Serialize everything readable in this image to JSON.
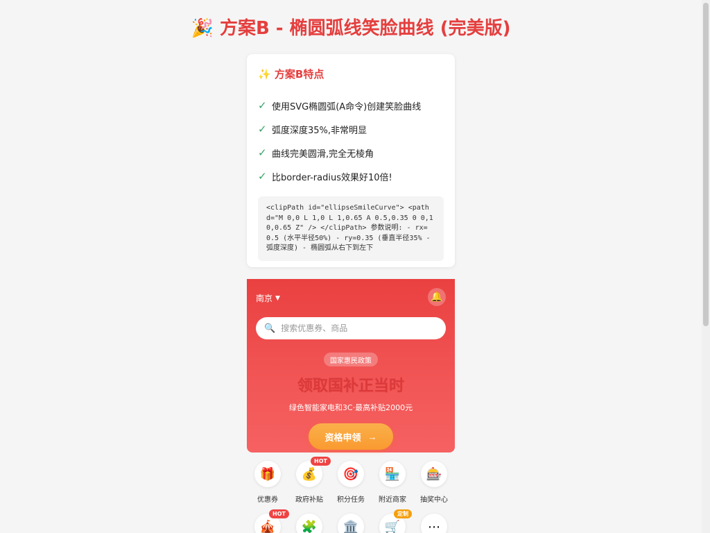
{
  "page": {
    "title": "🎉 方案B - 椭圆弧线笑脸曲线 (完美版)"
  },
  "card": {
    "title": "✨ 方案B特点",
    "features": [
      "使用SVG椭圆弧(A命令)创建笑脸曲线",
      "弧度深度35%,非常明显",
      "曲线完美圆滑,完全无棱角",
      "比border-radius效果好10倍!"
    ],
    "check_mark": "✓",
    "code": "<clipPath id=\"ellipseSmileCurve\"> <path d=\"M 0,0 L 1,0 L 1,0.65 A 0.5,0.35 0 0,1 0,0.65 Z\" /> </clipPath> 参数说明: - rx=0.5 (水平半径50%) - ry=0.35 (垂直半径35% - 弧度深度) - 椭圆弧从右下到左下"
  },
  "app": {
    "city": "南京",
    "city_arrow": "▼",
    "bell_icon": "🔔",
    "search": {
      "icon": "🔍",
      "placeholder": "搜索优惠券、商品"
    },
    "policy_tag": "国家惠民政策",
    "hero_title": "领取国补正当时",
    "hero_subtitle": "绿色智能家电和3C·最高补贴2000元",
    "apply_button": "资格申领",
    "apply_arrow": "→",
    "grid": [
      {
        "icon": "🎁",
        "label": "优惠券",
        "badge": ""
      },
      {
        "icon": "💰",
        "label": "政府补贴",
        "badge": "HOT"
      },
      {
        "icon": "🎯",
        "label": "积分任务",
        "badge": ""
      },
      {
        "icon": "🏪",
        "label": "附近商家",
        "badge": ""
      },
      {
        "icon": "🎰",
        "label": "抽奖中心",
        "badge": ""
      },
      {
        "icon": "🎪",
        "label": "",
        "badge": "HOT"
      },
      {
        "icon": "🧩",
        "label": "",
        "badge": ""
      },
      {
        "icon": "🏛️",
        "label": "",
        "badge": ""
      },
      {
        "icon": "🛒",
        "label": "",
        "badge": "定制"
      },
      {
        "icon": "⋯",
        "label": "",
        "badge": ""
      }
    ]
  },
  "colors": {
    "accent": "#e53e3e",
    "hero_red": "#ea4040",
    "button_orange": "#f99a30",
    "check_green": "#38a169"
  }
}
